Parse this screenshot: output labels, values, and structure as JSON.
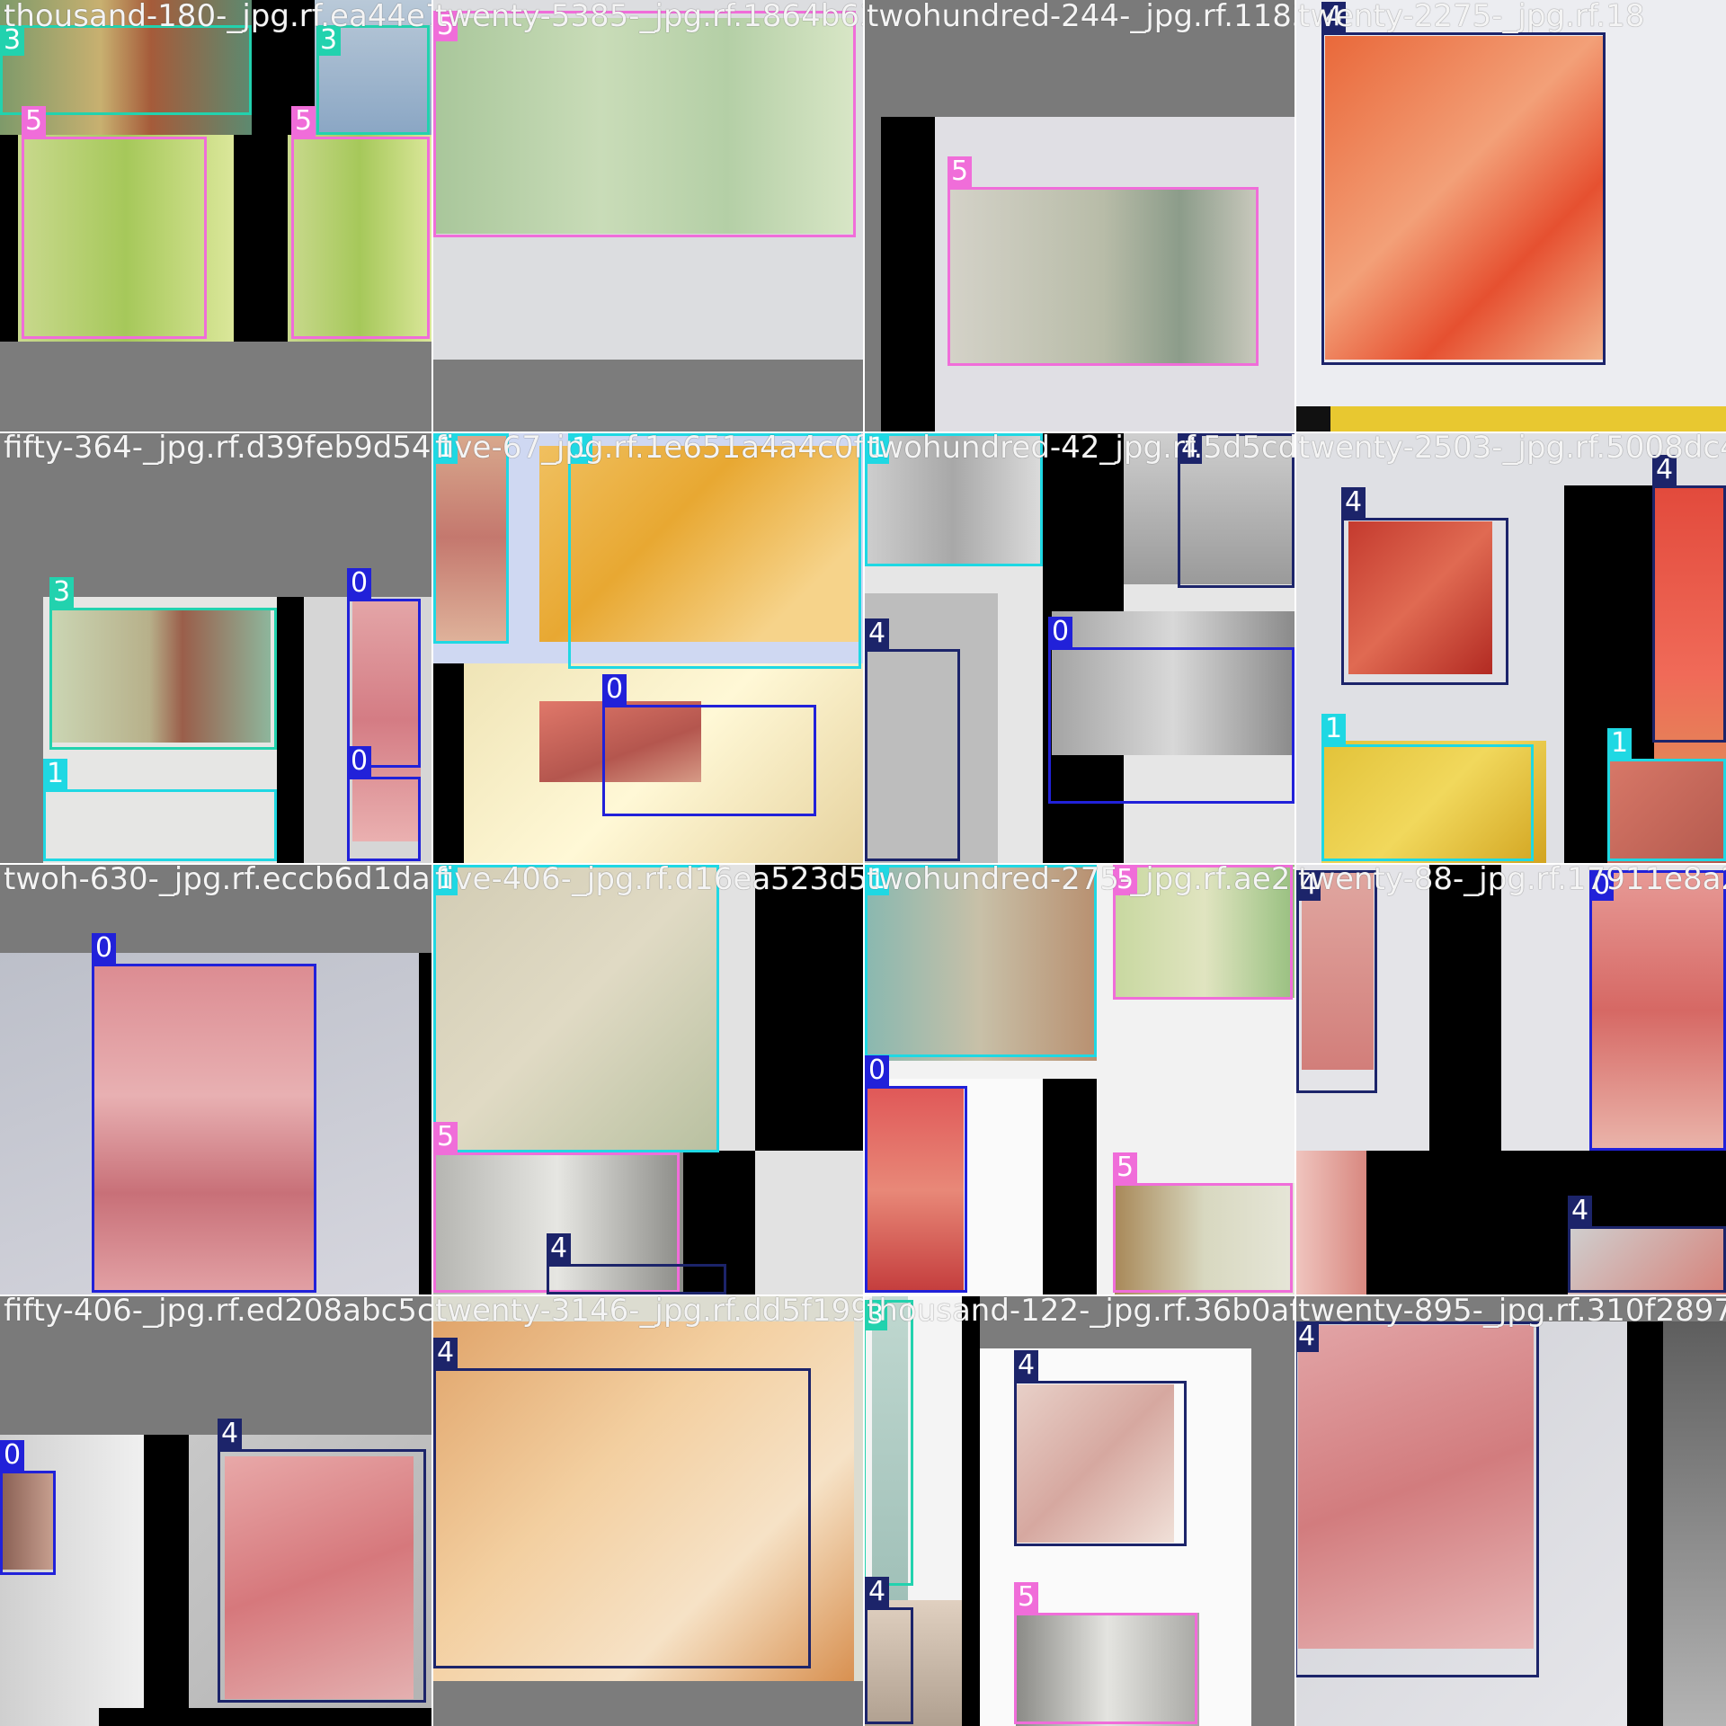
{
  "class_colors": {
    "0": "#2121d9",
    "1": "#1fd8e3",
    "3": "#22d2ae",
    "4": "#1c246a",
    "5": "#f06dd9"
  },
  "tiles": [
    {
      "filename": "thousand-180-_jpg.rf.ea44e7b81a5b5386fd",
      "labels": [
        "3",
        "3",
        "5",
        "5"
      ]
    },
    {
      "filename": "twenty-5385-_jpg.rf.1864b63c9",
      "labels": [
        "5"
      ]
    },
    {
      "filename": "twohundred-244-_jpg.rf.118340ab3",
      "labels": [
        "5"
      ]
    },
    {
      "filename": "twenty-2275-_jpg.rf.18",
      "labels": [
        "4"
      ]
    },
    {
      "filename": "fifty-364-_jpg.rf.d39feb9d544c5e75c3d4",
      "labels": [
        "3",
        "0",
        "0",
        "1"
      ]
    },
    {
      "filename": "five-67_jpg.rf.1e651a4a4c0f",
      "labels": [
        "1",
        "1",
        "0"
      ]
    },
    {
      "filename": "twohundred-42_jpg.rf.5d5cd0ba0b0e",
      "labels": [
        "1",
        "4",
        "4",
        "0"
      ]
    },
    {
      "filename": "twenty-2503-_jpg.rf.5008dc4a",
      "labels": [
        "4",
        "4",
        "1",
        "1"
      ]
    },
    {
      "filename": "twoh-630-_jpg.rf.eccb6d1da3",
      "labels": [
        "0"
      ]
    },
    {
      "filename": "five-406-_jpg.rf.d16ea523d5",
      "labels": [
        "1",
        "5",
        "4"
      ]
    },
    {
      "filename": "twohundred-275-_jpg.rf.ae27",
      "labels": [
        "1",
        "5",
        "0",
        "5"
      ]
    },
    {
      "filename": "twenty-88-_jpg.rf.17911e8a2",
      "labels": [
        "4",
        "0",
        "4"
      ]
    },
    {
      "filename": "fifty-406-_jpg.rf.ed208abc5c3",
      "labels": [
        "0",
        "4"
      ]
    },
    {
      "filename": "twenty-3146-_jpg.rf.dd5f19927",
      "labels": [
        "4"
      ]
    },
    {
      "filename": "thousand-122-_jpg.rf.36b0af0d",
      "labels": [
        "3",
        "4",
        "4",
        "5"
      ]
    },
    {
      "filename": "twenty-895-_jpg.rf.310f28973c",
      "labels": [
        "4"
      ]
    }
  ]
}
